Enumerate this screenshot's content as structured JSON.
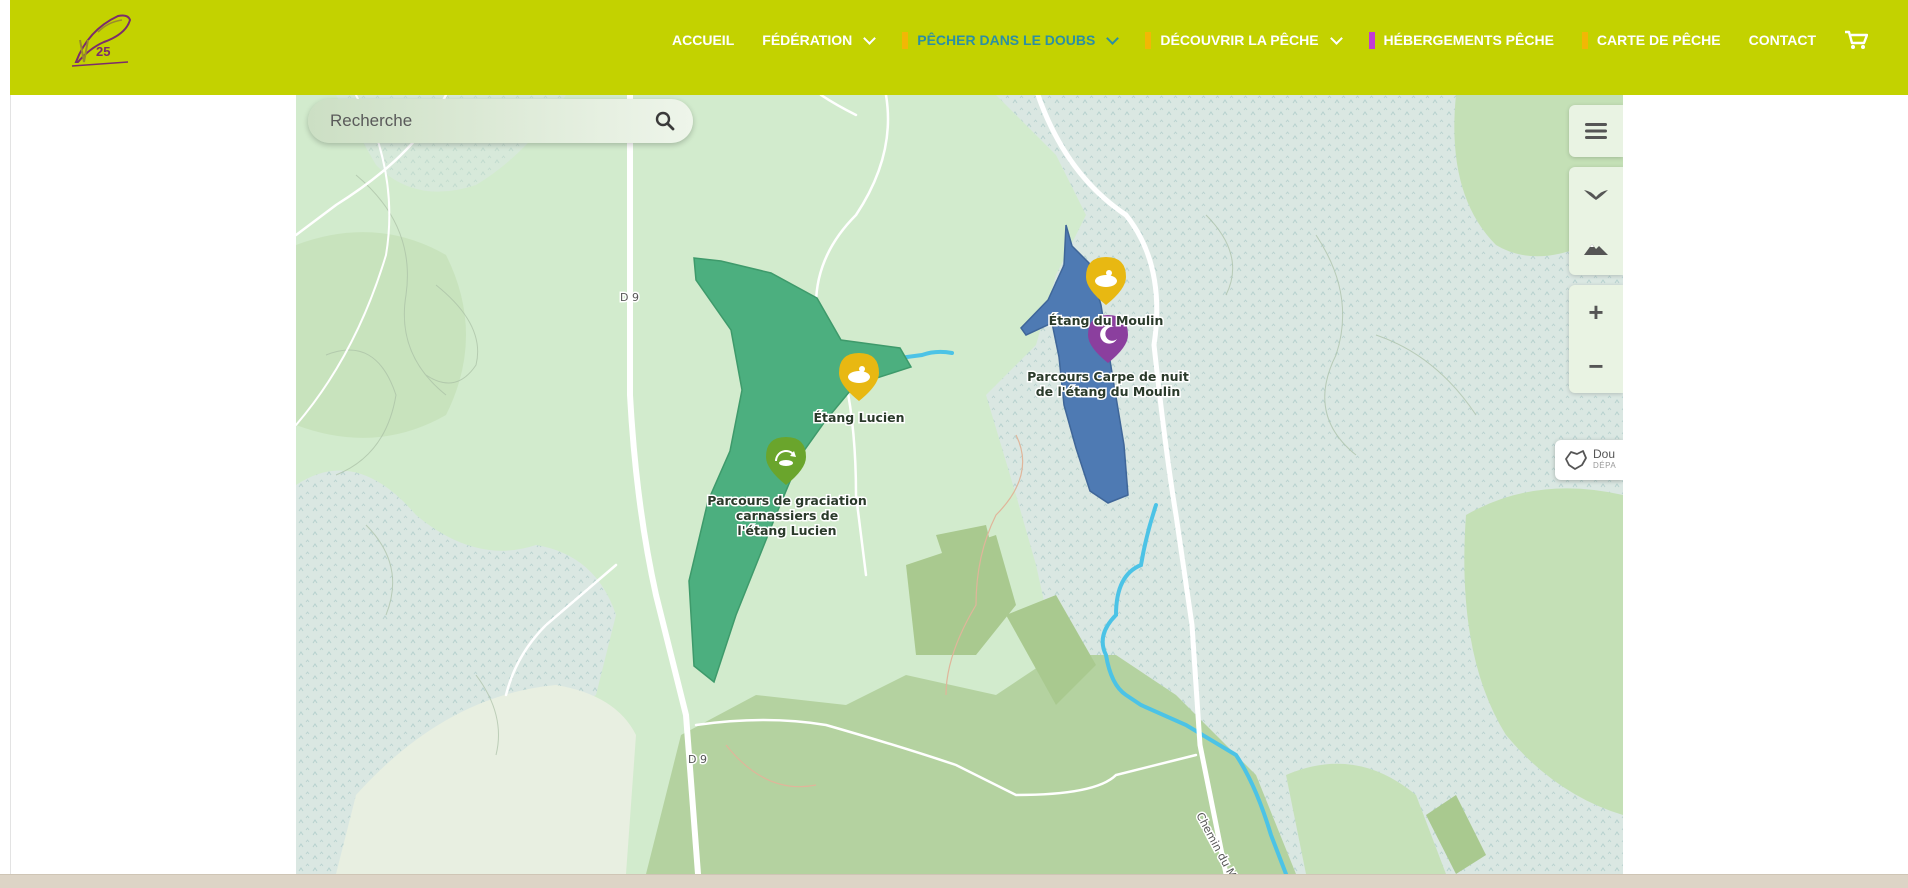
{
  "header": {
    "logo": {
      "text": "25",
      "icon": "fish-logo-icon",
      "color": "#7b2c6b"
    },
    "background": "#c3d200",
    "nav": [
      {
        "label": "ACCUEIL",
        "bar_color": null,
        "dropdown": false,
        "active": false
      },
      {
        "label": "FÉDÉRATION",
        "bar_color": null,
        "dropdown": true,
        "active": false
      },
      {
        "label": "PÊCHER DANS LE DOUBS",
        "bar_color": "#f2b705",
        "dropdown": true,
        "active": true
      },
      {
        "label": "DÉCOUVRIR LA PÊCHE",
        "bar_color": "#f2b705",
        "dropdown": true,
        "active": false
      },
      {
        "label": "HÉBERGEMENTS PÊCHE",
        "bar_color": "#c23bd4",
        "dropdown": false,
        "active": false
      },
      {
        "label": "CARTE DE PÊCHE",
        "bar_color": "#f2b705",
        "dropdown": false,
        "active": false
      },
      {
        "label": "CONTACT",
        "bar_color": null,
        "dropdown": false,
        "active": false
      }
    ],
    "cart_icon": "cart-icon"
  },
  "map": {
    "search": {
      "placeholder": "Recherche",
      "icon": "search-icon"
    },
    "controls": {
      "menu_icon": "hamburger-icon",
      "view_icons": [
        "bird-view-icon",
        "mountain-icon"
      ],
      "zoom_in": "+",
      "zoom_out": "−"
    },
    "department": {
      "label": "Dou",
      "sublabel": "DÉPA",
      "icon": "department-outline-icon"
    },
    "places": [
      {
        "name": "Étang Lucien",
        "icon": "lake-icon",
        "color": "#e8b812"
      },
      {
        "name_lines": [
          "Parcours de graciation",
          "carnassiers de",
          "l'étang Lucien"
        ],
        "icon": "catch-release-icon",
        "color": "#6aa52c"
      },
      {
        "name": "Étang du Moulin",
        "icon": "lake-icon",
        "color": "#e8b812"
      },
      {
        "name_lines": [
          "Parcours Carpe de nuit",
          "de l'étang du Moulin"
        ],
        "icon": "night-moon-icon",
        "color": "#8b3f9e"
      }
    ],
    "roads": [
      "D 9",
      "D 9",
      "Chemin du Moulin"
    ],
    "colors": {
      "land": "#d2ebcd",
      "forest": "#c4e0b6",
      "marsh": "#d9e6e2",
      "lake_lucien": "#4caf7f",
      "lake_moulin": "#4e7ab3",
      "river": "#4cc3e6"
    }
  }
}
